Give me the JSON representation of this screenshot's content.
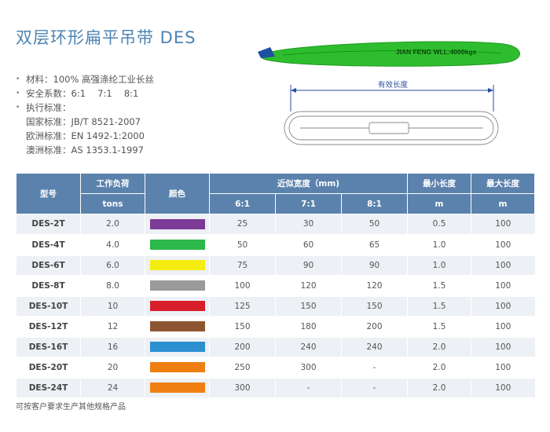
{
  "title": "双层环形扁平吊带 DES",
  "specs": {
    "material": "材料：100% 高强涤纶工业长丝",
    "safety": "安全系数：6:1　 7:1　 8:1",
    "standard_label": "执行标准：",
    "standards": [
      "国家标准：JB/T 8521-2007",
      "欧洲标准：EN 1492-1:2000",
      "澳洲标准：AS 1353.1-1997"
    ]
  },
  "illustration": {
    "band_text": "JIAN FENG WLL:4000kgs",
    "length_label": "有效长度",
    "band_color": "#2ebd2e"
  },
  "table": {
    "headers": {
      "model": "型号",
      "wll": "工作负荷",
      "wll_unit": "tons",
      "color": "颜色",
      "width": "近似宽度（mm)",
      "r6": "6:1",
      "r7": "7:1",
      "r8": "8:1",
      "min_len": "最小长度",
      "min_unit": "m",
      "max_len": "最大长度",
      "max_unit": "m"
    },
    "rows": [
      {
        "model": "DES-2T",
        "wll": "2.0",
        "color": "#7b3b96",
        "w6": "25",
        "w7": "30",
        "w8": "50",
        "min": "0.5",
        "max": "100"
      },
      {
        "model": "DES-4T",
        "wll": "4.0",
        "color": "#2db84a",
        "w6": "50",
        "w7": "60",
        "w8": "65",
        "min": "1.0",
        "max": "100"
      },
      {
        "model": "DES-6T",
        "wll": "6.0",
        "color": "#f5ec10",
        "w6": "75",
        "w7": "90",
        "w8": "90",
        "min": "1.0",
        "max": "100"
      },
      {
        "model": "DES-8T",
        "wll": "8.0",
        "color": "#9a9a9a",
        "w6": "100",
        "w7": "120",
        "w8": "120",
        "min": "1.5",
        "max": "100"
      },
      {
        "model": "DES-10T",
        "wll": "10",
        "color": "#d71e2b",
        "w6": "125",
        "w7": "150",
        "w8": "150",
        "min": "1.5",
        "max": "100"
      },
      {
        "model": "DES-12T",
        "wll": "12",
        "color": "#8d5633",
        "w6": "150",
        "w7": "180",
        "w8": "200",
        "min": "1.5",
        "max": "100"
      },
      {
        "model": "DES-16T",
        "wll": "16",
        "color": "#2b8fd0",
        "w6": "200",
        "w7": "240",
        "w8": "240",
        "min": "2.0",
        "max": "100"
      },
      {
        "model": "DES-20T",
        "wll": "20",
        "color": "#f07f12",
        "w6": "250",
        "w7": "300",
        "w8": "-",
        "min": "2.0",
        "max": "100"
      },
      {
        "model": "DES-24T",
        "wll": "24",
        "color": "#f07f12",
        "w6": "300",
        "w7": "-",
        "w8": "-",
        "min": "2.0",
        "max": "100"
      }
    ]
  },
  "footnote": "可按客户要求生产其他规格产品"
}
